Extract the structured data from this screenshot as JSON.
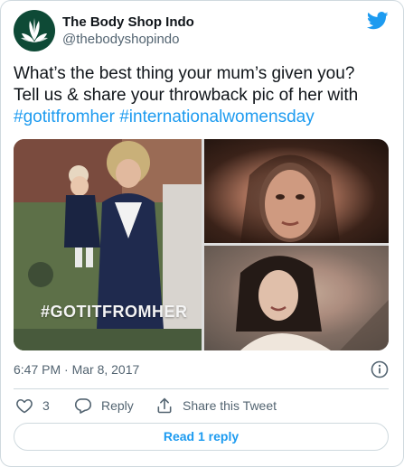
{
  "account": {
    "display_name": "The Body Shop Indo",
    "handle": "@thebodyshopindo"
  },
  "tweet": {
    "line1": "What’s the best thing your mum’s given you?",
    "line2": "Tell us & share your throwback pic of her with",
    "hashtag1": "#gotitfromher",
    "hashtag2": "#internationalwomensday"
  },
  "media": {
    "photo_tag": "#GOTITFROMHER"
  },
  "meta": {
    "timestamp": "6:47 PM · Mar 8, 2017"
  },
  "actions": {
    "like_count": "3",
    "reply_label": "Reply",
    "share_label": "Share this Tweet"
  },
  "read_replies_label": "Read 1 reply",
  "icons": {
    "brand": "twitter-bird-icon",
    "avatar_logo": "leaf-logo-icon",
    "like": "heart-icon",
    "reply": "reply-icon",
    "share": "share-icon",
    "info": "info-icon"
  },
  "colors": {
    "accent": "#1d9bf0",
    "text": "#0f1419",
    "secondary": "#536471",
    "border": "#cfd9de",
    "avatar_bg": "#0e4a36"
  }
}
